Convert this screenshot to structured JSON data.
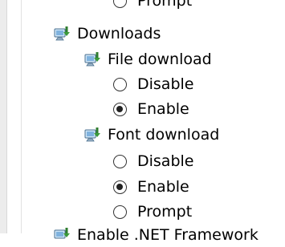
{
  "tree": {
    "prompt_top": "Prompt",
    "downloads": "Downloads",
    "file_download": "File download",
    "file_options": [
      "Disable",
      "Enable"
    ],
    "font_download": "Font download",
    "font_options": [
      "Disable",
      "Enable",
      "Prompt"
    ],
    "next_item_partial": "Enable .NET Framework"
  },
  "state": {
    "file_download_selected": "Enable",
    "font_download_selected": "Enable"
  }
}
